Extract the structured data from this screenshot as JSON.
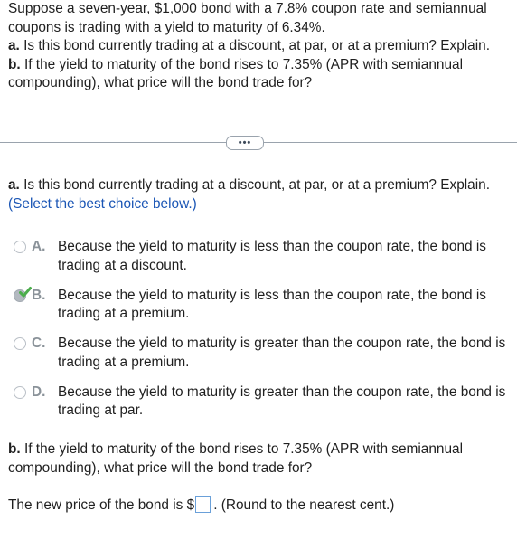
{
  "problem": {
    "intro": "Suppose a seven-year, $1,000 bond with a 7.8% coupon rate and semiannual coupons is trading with a yield to maturity of 6.34%.",
    "a_label": "a.",
    "a_text": "Is this bond currently trading at a discount, at par, or at a premium? Explain.",
    "b_label": "b.",
    "b_text": "If the yield to maturity of the bond rises to 7.35% (APR with semiannual compounding), what price will the bond trade for?"
  },
  "divider": {
    "button_label": "•••"
  },
  "part_a": {
    "label": "a.",
    "question": "Is this bond currently trading at a discount, at par, or at a premium? Explain.",
    "hint": "(Select the best choice below.)",
    "choices": [
      {
        "letter": "A.",
        "text": "Because the yield to maturity is less than the coupon rate, the bond is trading at a discount.",
        "selected": false
      },
      {
        "letter": "B.",
        "text": "Because the yield to maturity is less than the coupon rate, the bond is trading at a premium.",
        "selected": true
      },
      {
        "letter": "C.",
        "text": "Because the yield to maturity is greater than the coupon rate, the bond is trading at a premium.",
        "selected": false
      },
      {
        "letter": "D.",
        "text": "Because the yield to maturity is greater than the coupon rate, the bond is trading at par.",
        "selected": false
      }
    ]
  },
  "part_b": {
    "label": "b.",
    "question": "If the yield to maturity of the bond rises to 7.35% (APR with semiannual compounding), what price will the bond trade for?",
    "answer_prefix": "The new price of the bond is $",
    "answer_value": "",
    "answer_suffix": ". (Round to the nearest cent.)"
  },
  "colors": {
    "hint": "#1b56b5",
    "check": "#4cae4c",
    "input_border": "#6aa0d9"
  },
  "icons": {
    "selected_check": "checkmark-icon",
    "more": "ellipsis-icon"
  }
}
